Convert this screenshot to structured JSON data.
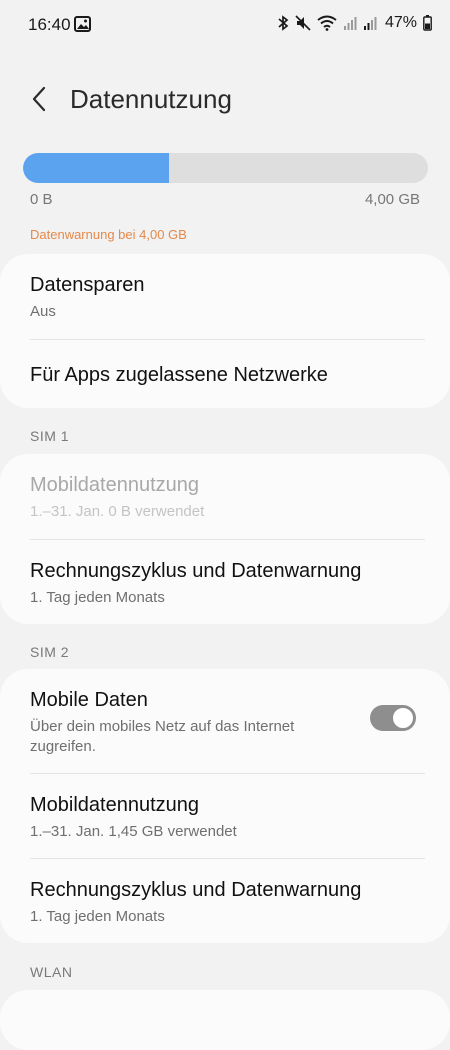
{
  "status_bar": {
    "time": "16:40",
    "battery": "47%",
    "icons": [
      "bluetooth-icon",
      "mute-icon",
      "wifi-icon",
      "signal-icon",
      "signal-icon",
      "battery-icon"
    ]
  },
  "header": {
    "title": "Datennutzung"
  },
  "usage": {
    "min_label": "0 B",
    "max_label": "4,00 GB",
    "fill_fraction": 0.36,
    "fill_color": "#5ba2ef",
    "warning": "Datenwarnung bei 4,00 GB",
    "warning_color": "#e5894a"
  },
  "card1": {
    "data_saver_title": "Datensparen",
    "data_saver_value": "Aus",
    "allowed_networks": "Für Apps zugelassene Netzwerke"
  },
  "sim1": {
    "label": "SIM 1",
    "mobile_usage_title": "Mobildatennutzung",
    "mobile_usage_sub": "1.–31. Jan. 0 B verwendet",
    "billing_title": "Rechnungszyklus und Datenwarnung",
    "billing_sub": "1. Tag jeden Monats"
  },
  "sim2": {
    "label": "SIM 2",
    "mobile_data_title": "Mobile Daten",
    "mobile_data_sub": "Über dein mobiles Netz auf das Internet zugreifen.",
    "mobile_data_enabled": true,
    "mobile_usage_title": "Mobildatennutzung",
    "mobile_usage_sub": "1.–31. Jan. 1,45 GB verwendet",
    "billing_title": "Rechnungszyklus und Datenwarnung",
    "billing_sub": "1. Tag jeden Monats"
  },
  "wlan": {
    "label": "WLAN"
  }
}
